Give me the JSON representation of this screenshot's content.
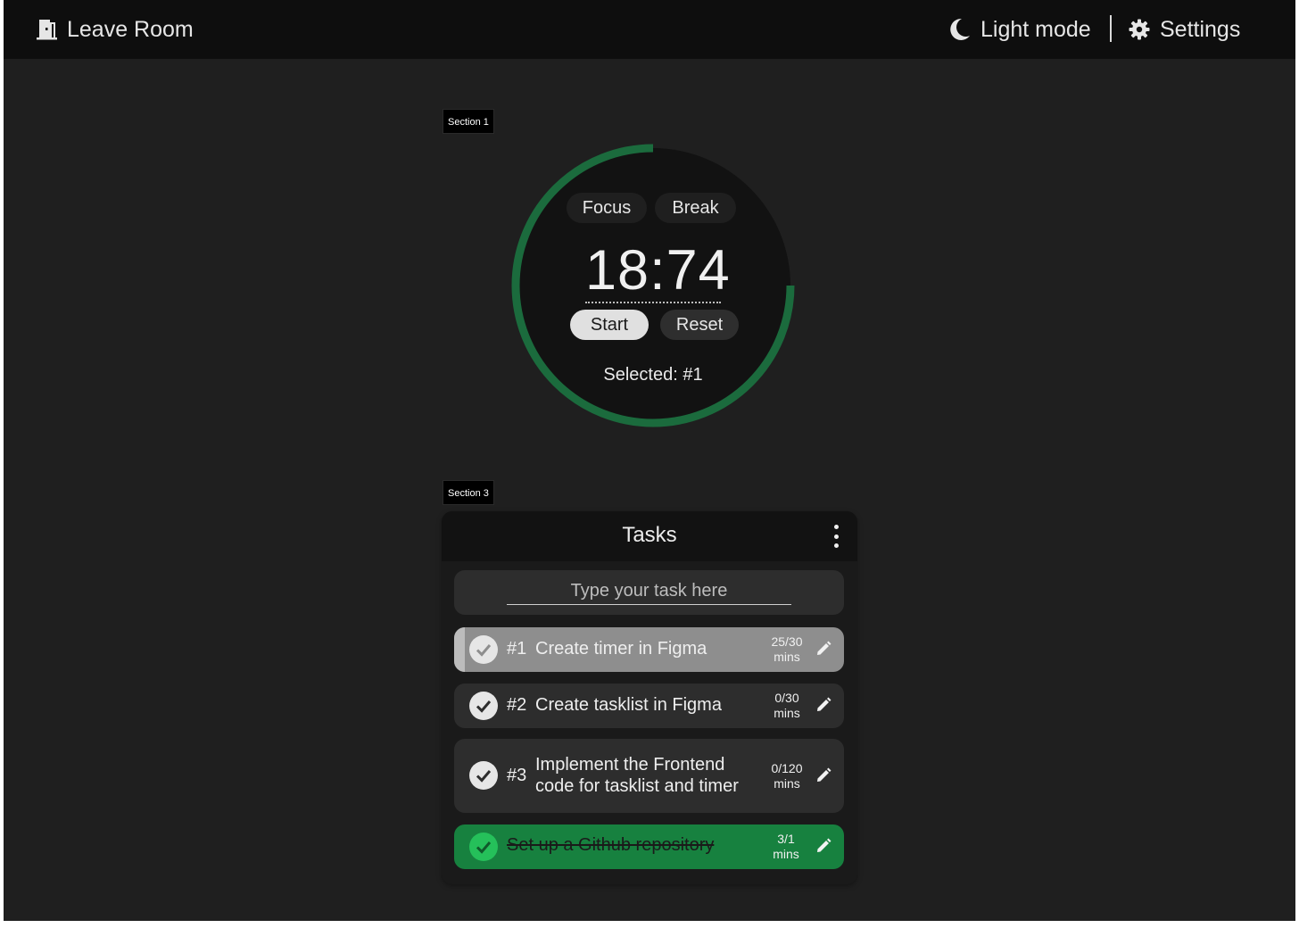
{
  "topbar": {
    "leave_label": "Leave Room",
    "lightmode_label": "Light mode",
    "settings_label": "Settings"
  },
  "section_tags": {
    "section1": "Section 1",
    "section3": "Section 3"
  },
  "timer": {
    "focus_label": "Focus",
    "break_label": "Break",
    "time": "18:74",
    "start_label": "Start",
    "reset_label": "Reset",
    "selected_text": "Selected: #1",
    "progress_fraction": 0.75,
    "ring_color": "#1b6b3d"
  },
  "tasks": {
    "title": "Tasks",
    "input_placeholder": "Type your task here",
    "items": [
      {
        "num": "#1",
        "title": "Create timer in Figma",
        "minutes": "25/30",
        "unit": "mins",
        "state": "selected"
      },
      {
        "num": "#2",
        "title": "Create tasklist in Figma",
        "minutes": "0/30",
        "unit": "mins",
        "state": "normal"
      },
      {
        "num": "#3",
        "title_line1": "Implement the Frontend",
        "title_line2": "code for tasklist and timer",
        "minutes": "0/120",
        "unit": "mins",
        "state": "normal"
      },
      {
        "title": "Set up a Github repository",
        "minutes": "3/1",
        "unit": "mins",
        "state": "completed"
      }
    ]
  },
  "colors": {
    "background": "#1f1f1f",
    "topbar": "#0e0e0e",
    "completed": "#17813f",
    "selected_task": "#8e8e8e"
  }
}
